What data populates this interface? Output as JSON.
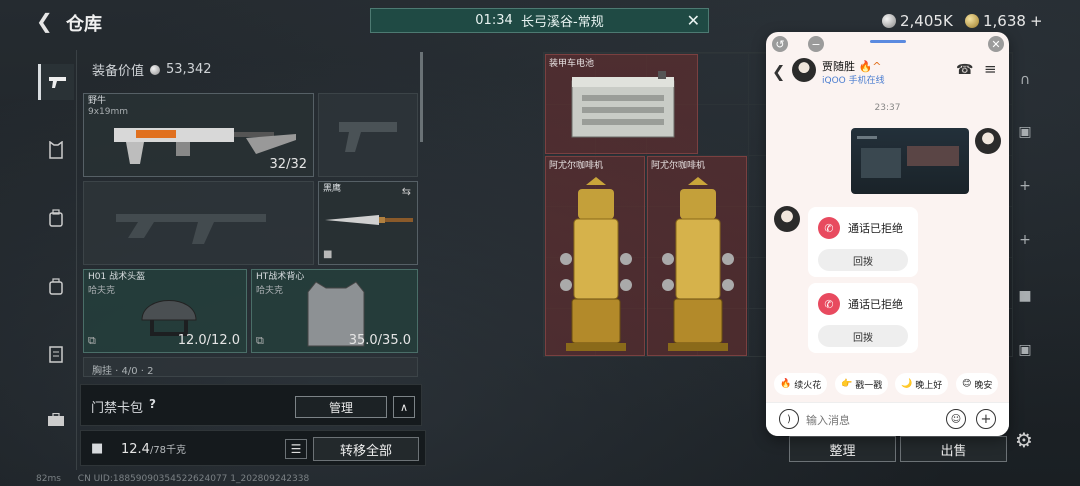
{
  "header": {
    "back_glyph": "❮",
    "title": "仓库",
    "match_time": "01:34",
    "match_name": "长弓溪谷-常规",
    "close_glyph": "✕",
    "currency_silver": "2,405K",
    "currency_gold": "1,638"
  },
  "left_nav": {
    "items": [
      {
        "icon": "pistol-icon",
        "glyph": "⌁"
      },
      {
        "icon": "armor-icon",
        "glyph": "⚓"
      },
      {
        "icon": "backpack-icon",
        "glyph": "▣"
      },
      {
        "icon": "bag-icon",
        "glyph": "▤"
      },
      {
        "icon": "clipboard-icon",
        "glyph": "▥"
      },
      {
        "icon": "briefcase-icon",
        "glyph": "▦"
      }
    ]
  },
  "equipment": {
    "value_label": "装备价值",
    "value": "53,342",
    "primary_weapon": {
      "name": "野牛",
      "caliber": "9x19mm",
      "ammo": "32/32"
    },
    "knife": {
      "name": "黑鹰"
    },
    "helmet": {
      "name": "H01 战术头盔",
      "brand": "哈夫克",
      "durability": "12.0/12.0"
    },
    "vest": {
      "name": "HT战术背心",
      "brand": "哈夫克",
      "durability": "35.0/35.0"
    },
    "chest_partial": "胸挂 · 4/0 · 2"
  },
  "cardpack": {
    "label": "门禁卡包",
    "help": "?",
    "manage": "管理",
    "collapse": "∧"
  },
  "bottom_bar": {
    "weight": "12.4",
    "weight_unit": "/78千克",
    "transfer_all": "转移全部",
    "list_glyph": "☰",
    "lock_glyph": "■"
  },
  "storage": {
    "items": [
      {
        "name": "装甲车电池"
      },
      {
        "name": "阿尤尔咖啡机"
      },
      {
        "name": "阿尤尔咖啡机"
      }
    ],
    "sort": "整理",
    "sell": "出售"
  },
  "status": {
    "ping": "82ms",
    "uid": "CN UID:18859090354522624077 1_202809242338"
  },
  "chat": {
    "contact_name": "贾随胜",
    "contact_badge": "🔥^",
    "contact_status": "iQOO 手机在线",
    "time": "23:37",
    "calls": [
      {
        "text": "通话已拒绝",
        "redial": "回拨"
      },
      {
        "text": "通话已拒绝",
        "redial": "回拨"
      }
    ],
    "quick_replies": [
      {
        "emoji": "🔥",
        "text": "续火花"
      },
      {
        "emoji": "👉",
        "text": "戳一戳"
      },
      {
        "emoji": "🌙",
        "text": "晚上好"
      },
      {
        "emoji": "😊",
        "text": "晚安"
      }
    ],
    "input_placeholder": "输入消息",
    "back_glyph": "❮",
    "phone_glyph": "☎",
    "menu_glyph": "≡"
  },
  "colors": {
    "accent_teal": "#1f4a44",
    "item_red": "#7a4040",
    "call_red": "#e84a5f",
    "chat_bg": "#fbf3f1"
  }
}
